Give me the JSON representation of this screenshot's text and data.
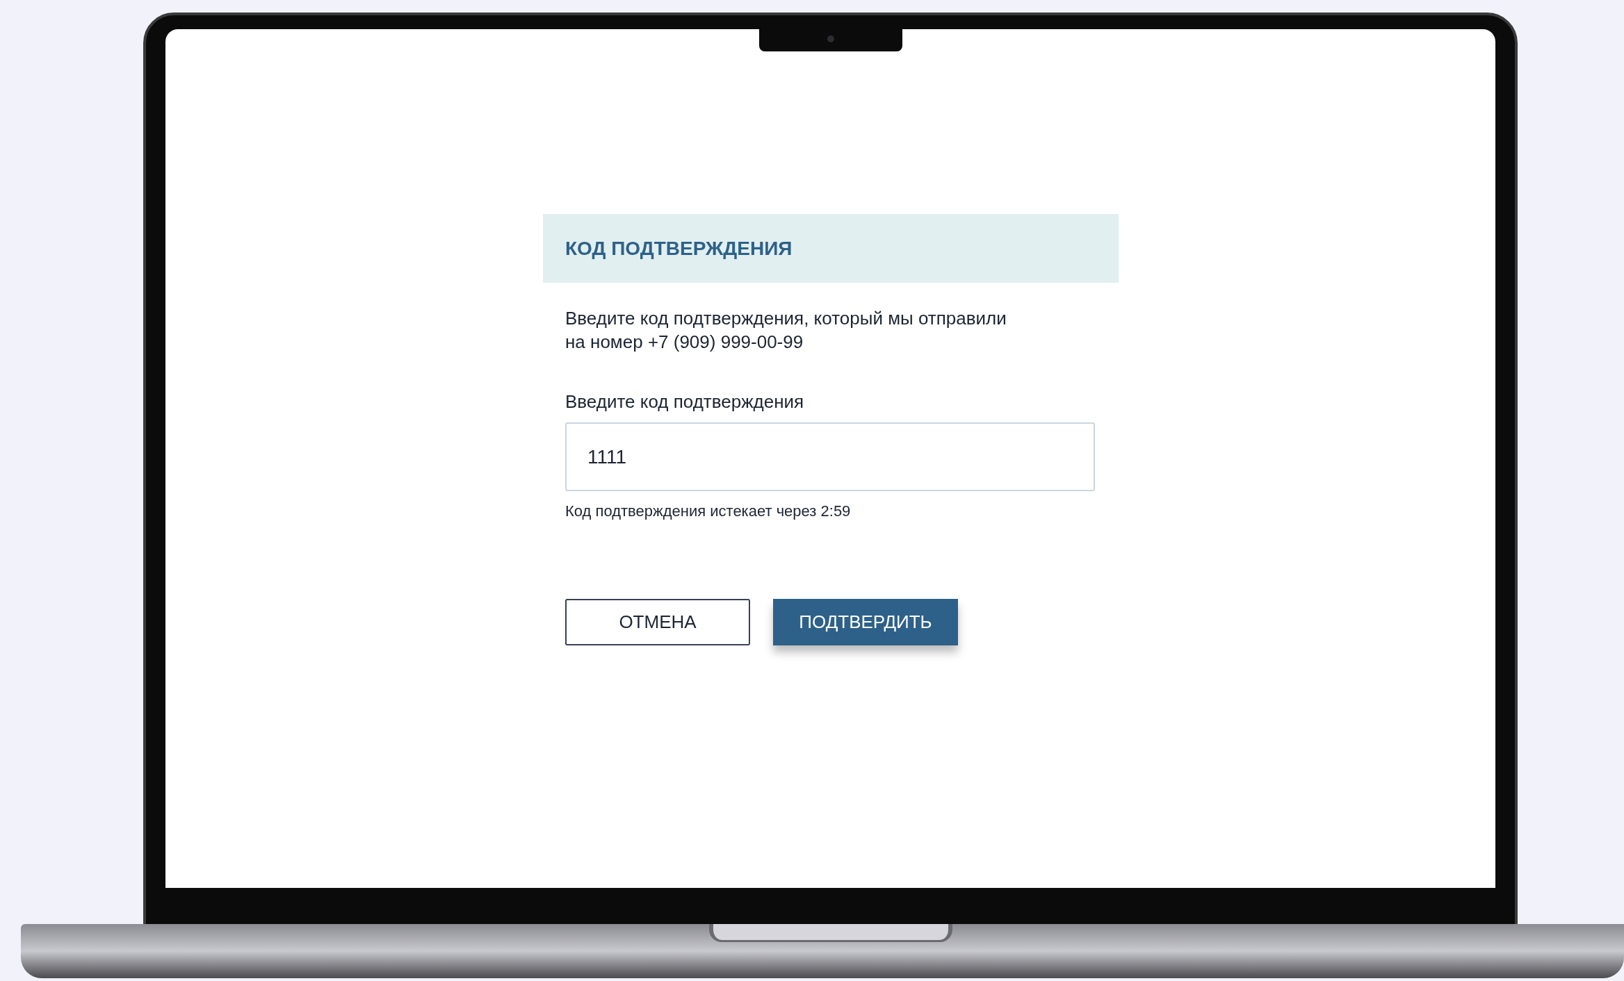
{
  "dialog": {
    "title": "КОД ПОДТВЕРЖДЕНИЯ",
    "message": "Введите код подтверждения, который мы отправили\nна номер +7 (909) 999-00-99",
    "field": {
      "label": "Введите код подтверждения",
      "value": "1111",
      "hint": "Код подтверждения истекает через 2:59"
    },
    "buttons": [
      {
        "label": "ОТМЕНА",
        "kind": "secondary"
      },
      {
        "label": "ПОДТВЕРДИТЬ",
        "kind": "primary"
      }
    ]
  }
}
